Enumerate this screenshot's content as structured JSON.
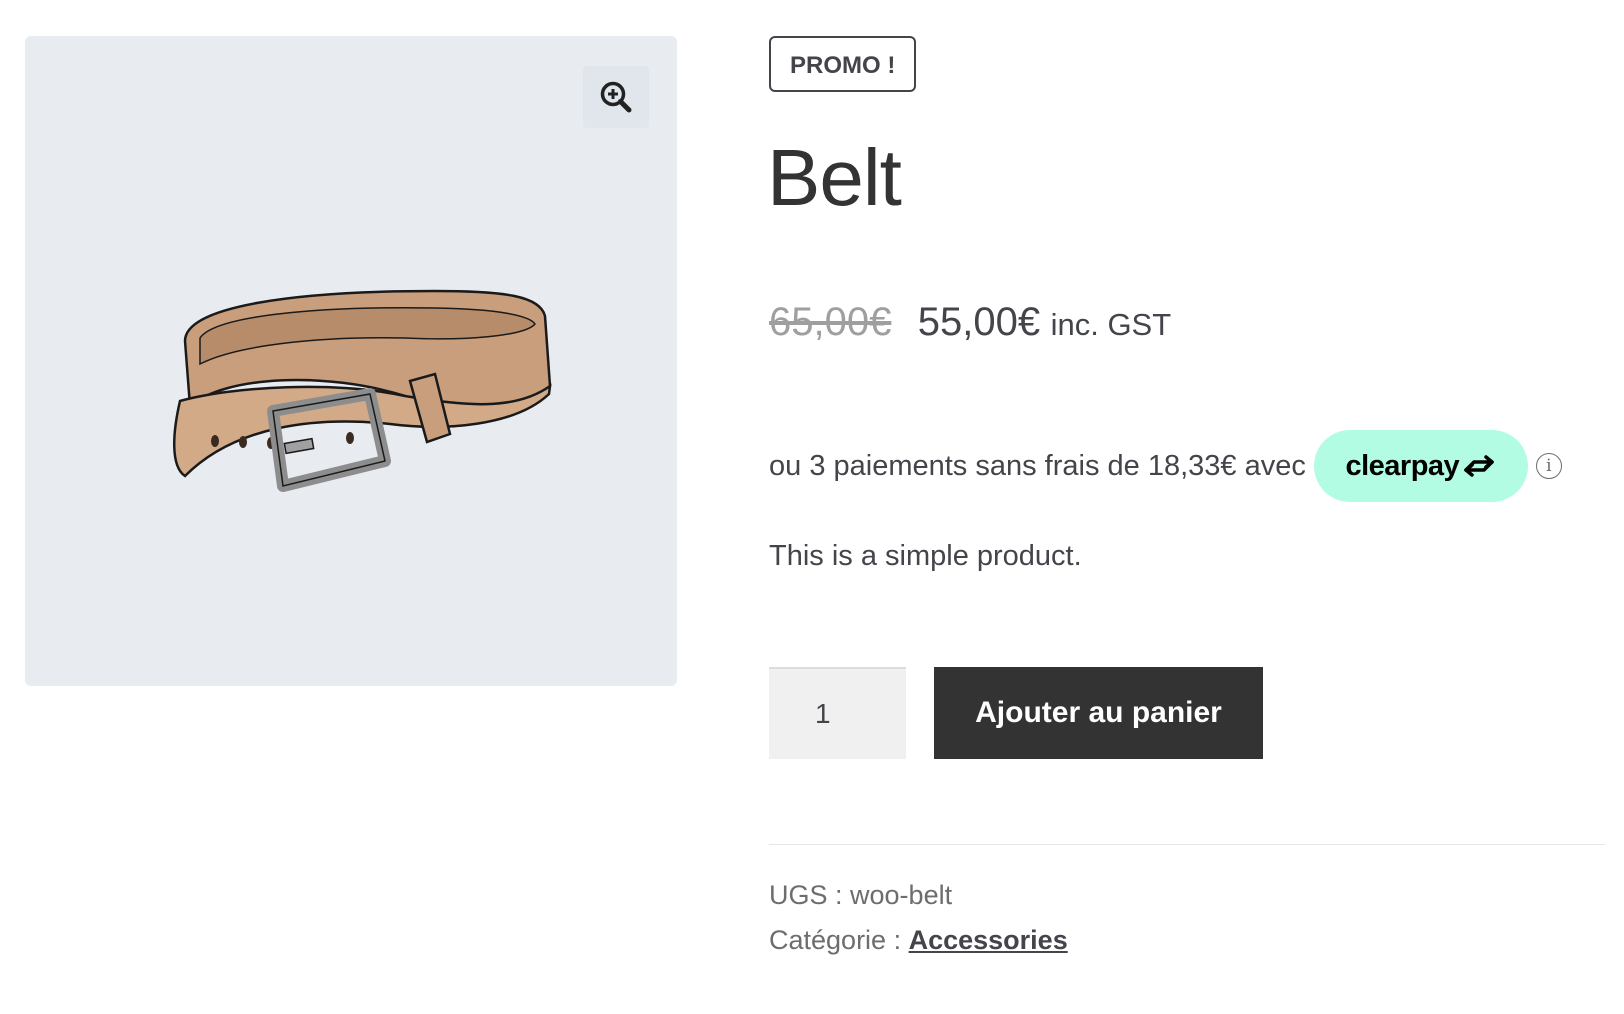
{
  "gallery": {
    "zoom_icon": "magnifier-plus-icon",
    "image_subject": "belt-illustration"
  },
  "product": {
    "badge": "PROMO !",
    "title": "Belt",
    "price": {
      "old": "65,00€",
      "current": "55,00€",
      "suffix": "inc. GST"
    },
    "installments": {
      "text": "ou 3 paiements sans frais de 18,33€ avec",
      "provider": "clearpay",
      "provider_color": "#b2fce4",
      "info_icon": "info-circle-icon",
      "info_glyph": "i"
    },
    "short_description": "This is a simple product.",
    "quantity": "1",
    "add_to_cart_label": "Ajouter au panier",
    "meta": {
      "sku_label": "UGS :",
      "sku_value": "woo-belt",
      "category_label": "Catégorie :",
      "category_value": "Accessories"
    }
  },
  "colors": {
    "text": "#43454b",
    "button": "#333333",
    "gallery_bg": "#e8ecf1"
  }
}
